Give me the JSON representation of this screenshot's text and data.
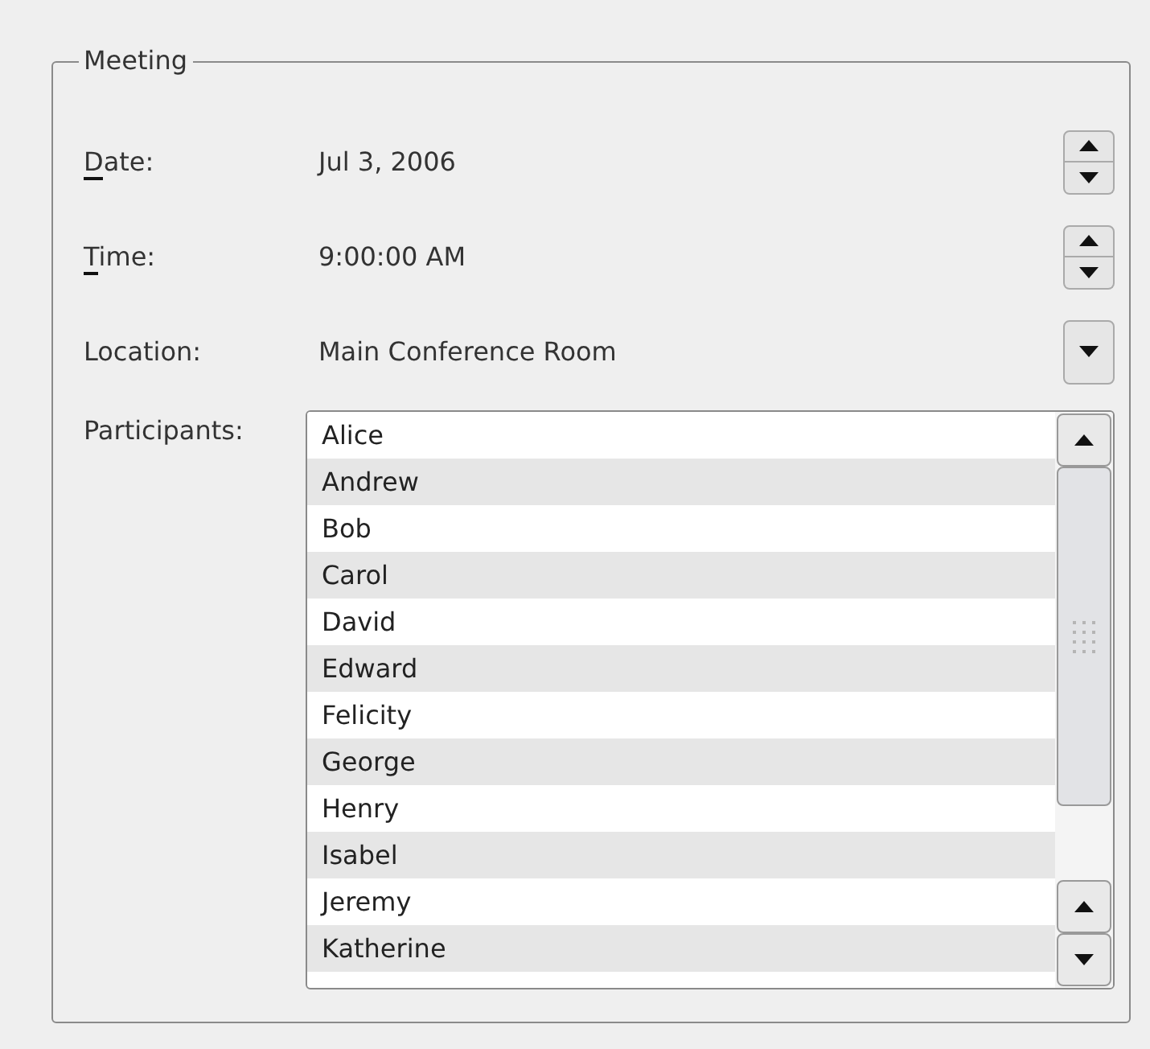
{
  "group": {
    "title": "Meeting"
  },
  "fields": [
    {
      "kind": "spinner",
      "label": "Date:",
      "mnemonic": true,
      "value": "Jul 3, 2006"
    },
    {
      "kind": "spinner",
      "label": "Time:",
      "mnemonic": true,
      "value": "9:00:00 AM"
    },
    {
      "kind": "combo",
      "label": "Location:",
      "mnemonic": false,
      "value": "Main Conference Room"
    }
  ],
  "participants": {
    "label": "Participants:",
    "items": [
      "Alice",
      "Andrew",
      "Bob",
      "Carol",
      "David",
      "Edward",
      "Felicity",
      "George",
      "Henry",
      "Isabel",
      "Jeremy",
      "Katherine"
    ]
  }
}
